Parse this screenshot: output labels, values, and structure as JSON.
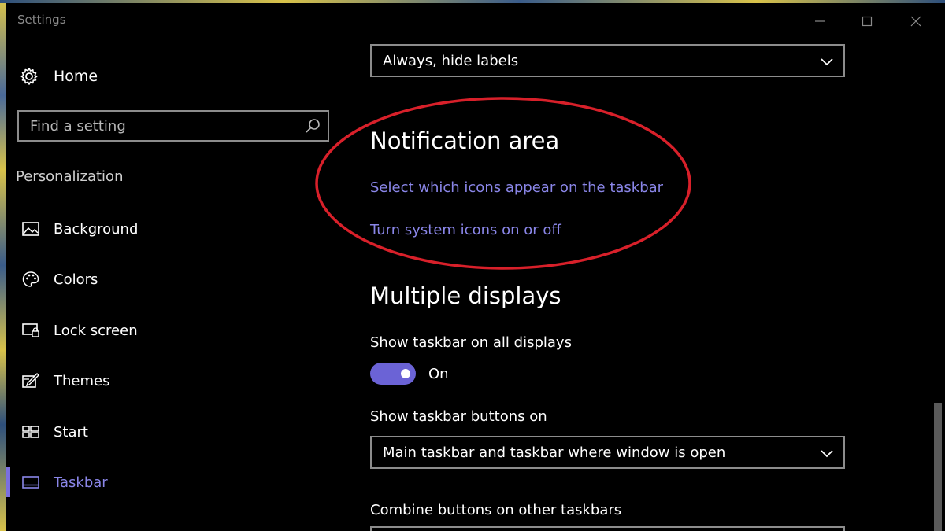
{
  "window": {
    "title": "Settings"
  },
  "sidebar": {
    "home_label": "Home",
    "search_placeholder": "Find a setting",
    "section_label": "Personalization",
    "items": [
      {
        "label": "Background",
        "icon": "image-icon"
      },
      {
        "label": "Colors",
        "icon": "palette-icon"
      },
      {
        "label": "Lock screen",
        "icon": "lock-screen-icon"
      },
      {
        "label": "Themes",
        "icon": "themes-icon"
      },
      {
        "label": "Start",
        "icon": "start-icon"
      },
      {
        "label": "Taskbar",
        "icon": "taskbar-icon",
        "active": true
      }
    ]
  },
  "main": {
    "top_dropdown_value": "Always, hide labels",
    "notification_area": {
      "heading": "Notification area",
      "link_icons": "Select which icons appear on the taskbar",
      "link_system": "Turn system icons on or off"
    },
    "multiple_displays": {
      "heading": "Multiple displays",
      "show_taskbar_label": "Show taskbar on all displays",
      "toggle_state": "On",
      "buttons_on_label": "Show taskbar buttons on",
      "buttons_on_value": "Main taskbar and taskbar where window is open",
      "combine_label": "Combine buttons on other taskbars"
    }
  },
  "colors": {
    "accent": "#7a6fe0",
    "link": "#8a86e8",
    "annotation": "#d8202a"
  }
}
